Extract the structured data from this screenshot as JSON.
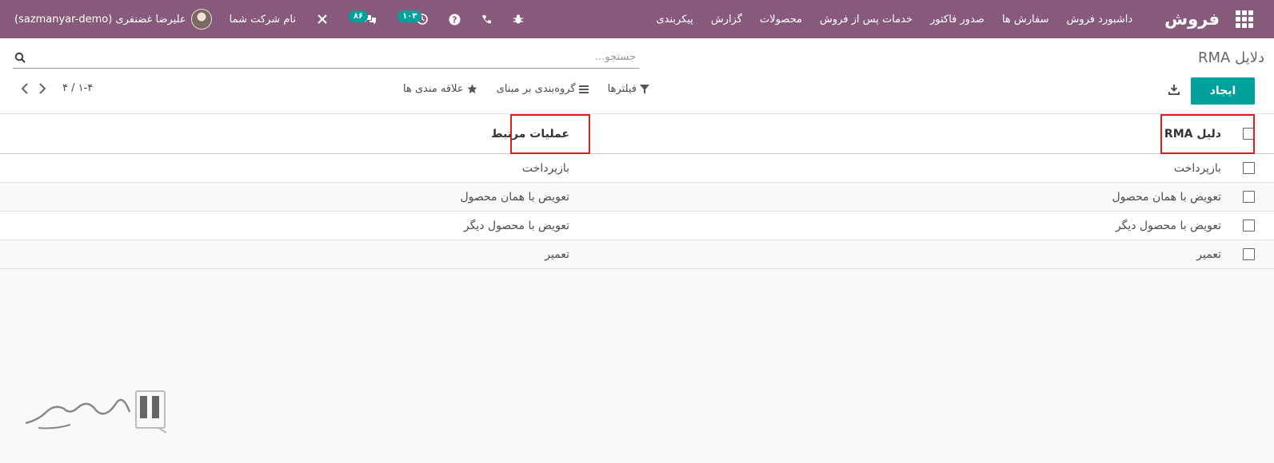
{
  "navbar": {
    "brand": "فروش",
    "menu": [
      "داشبورد فروش",
      "سفارش ها",
      "صدور فاکتور",
      "خدمات پس از فروش",
      "محصولات",
      "گزارش",
      "پیکربندی"
    ],
    "activity_badge": "۱۰۳",
    "message_badge": "۸۶",
    "company": "نام شرکت شما",
    "user": "علیرضا غضنفری (sazmanyar-demo)"
  },
  "control_panel": {
    "breadcrumb": "دلایل RMA",
    "search_placeholder": "جستجو...",
    "create_label": "ایجاد",
    "filters_label": "فیلترها",
    "group_by_label": "گروه‌بندی بر مبنای",
    "favorites_label": "علاقه مندی ها",
    "pager_value": "۱-۴ / ۴"
  },
  "list": {
    "columns": [
      "دلیل RMA",
      "عملیات مرتبط"
    ],
    "rows": [
      {
        "name": "بازپرداخت",
        "operation": "بازپرداخت"
      },
      {
        "name": "تعویض با همان محصول",
        "operation": "تعویض با همان محصول"
      },
      {
        "name": "تعویض با محصول دیگر",
        "operation": "تعویض با محصول دیگر"
      },
      {
        "name": "تعمیر",
        "operation": "تعمیر"
      }
    ]
  },
  "colors": {
    "navbar": "#875a7b",
    "primary": "#00a09d",
    "highlight": "#e11b22"
  },
  "icons": [
    "apps-grid-icon",
    "bug-icon",
    "phone-icon",
    "help-icon",
    "clock-icon",
    "chat-icon",
    "tools-icon",
    "search-icon",
    "download-icon",
    "filter-icon",
    "list-icon",
    "star-icon",
    "chevron-left-icon",
    "chevron-right-icon"
  ]
}
